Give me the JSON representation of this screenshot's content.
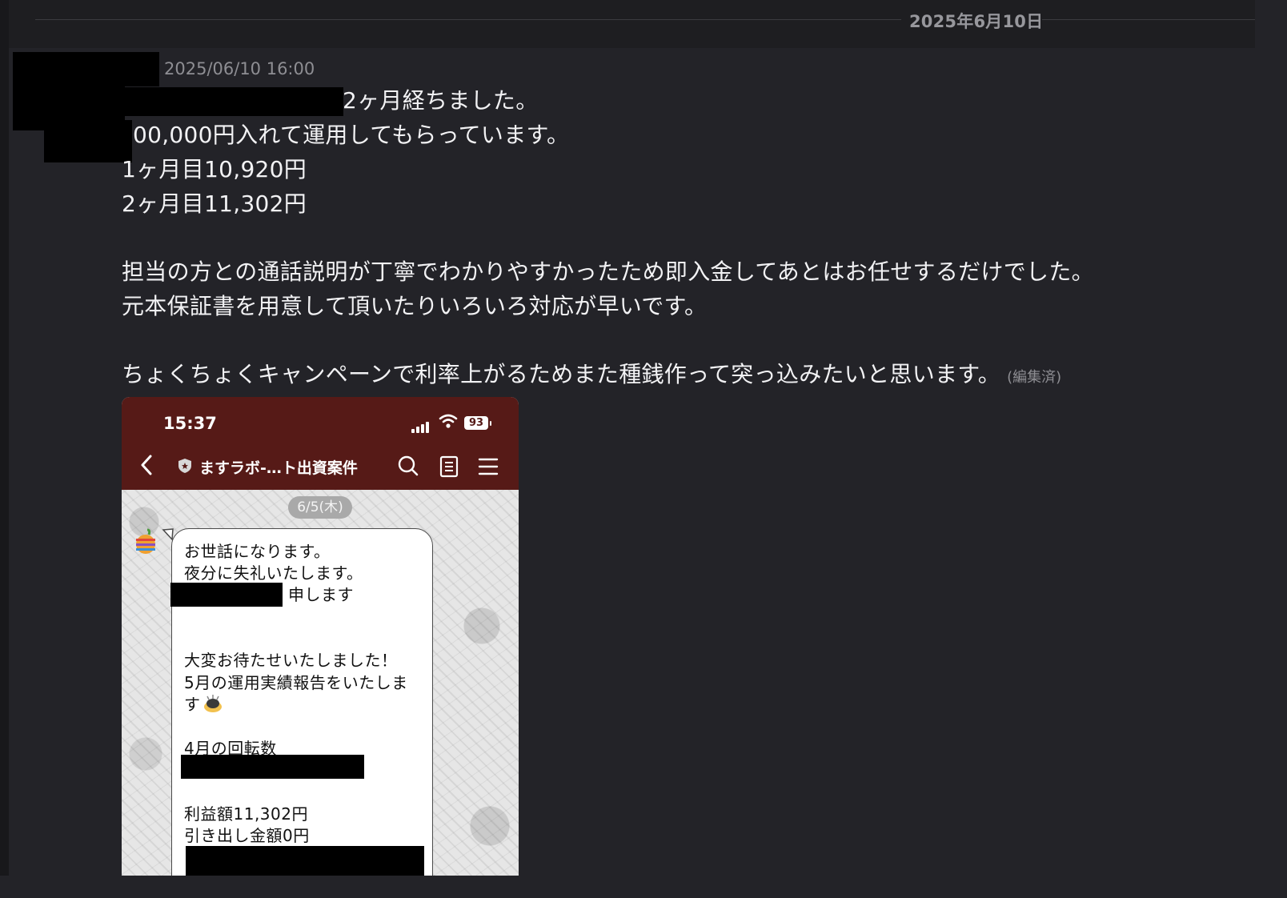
{
  "date_separator": "2025年6月10日",
  "post": {
    "timestamp": "2025/06/10 16:00",
    "lines": [
      "2ヶ月経ちました。",
      "00,000円入れて運用してもらっています。",
      "1ヶ月目10,920円",
      "2ヶ月目11,302円",
      "担当の方との通話説明が丁寧でわかりやすかったため即入金してあとはお任せするだけでした。",
      "元本保証書を用意して頂いたりいろいろ対応が早いです。",
      "ちょくちょくキャンペーンで利率上がるためまた種銭作って突っ込みたいと思います。"
    ],
    "edited_label": "(編集済)"
  },
  "attachment": {
    "status_bar": {
      "time": "15:37",
      "battery": "93"
    },
    "chat_header": {
      "title": "ますラボ-…ト出資案件"
    },
    "date_pill": "6/5(木)",
    "message_lines": [
      "お世話になります。",
      "夜分に失礼いたします。",
      "申します",
      "大変お待たせいたしました！",
      "5月の運用実績報告をいたしま",
      "す",
      "4月の回転数",
      "利益額11,302円",
      "引き出し金額0円"
    ]
  },
  "colors": {
    "background": "#232328",
    "header_band": "#1e1e21",
    "phone_header": "#561a17",
    "text": "#f2f2f4",
    "muted": "#8e8e93"
  },
  "icons": [
    "back-chevron-icon",
    "shield-icon",
    "search-icon",
    "notes-icon",
    "menu-icon",
    "signal-icon",
    "wifi-icon",
    "battery-icon",
    "apple-avatar-icon",
    "bowing-emoji-icon"
  ]
}
